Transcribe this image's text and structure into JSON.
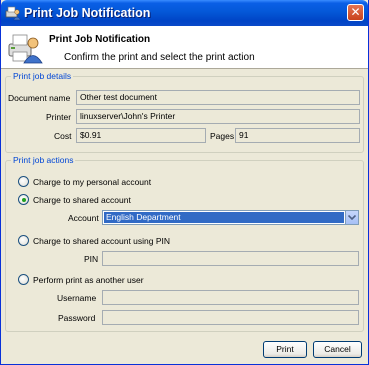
{
  "window": {
    "title": "Print Job Notification",
    "close_label": "✕"
  },
  "header": {
    "title": "Print Job Notification",
    "subtitle": "Confirm the print and select the print action"
  },
  "details": {
    "group_title": "Print job details",
    "document_label": "Document name",
    "document_value": "Other test document",
    "printer_label": "Printer",
    "printer_value": "linuxserver\\John's Printer",
    "cost_label": "Cost",
    "cost_value": "$0.91",
    "pages_label": "Pages",
    "pages_value": "91"
  },
  "actions": {
    "group_title": "Print job actions",
    "options": [
      {
        "label": "Charge to my personal account",
        "selected": false
      },
      {
        "label": "Charge to shared account",
        "selected": true
      },
      {
        "label": "Charge to shared account using PIN",
        "selected": false
      },
      {
        "label": "Perform print as another user",
        "selected": false
      }
    ],
    "account_label": "Account",
    "account_value": "English Department",
    "pin_label": "PIN",
    "pin_value": "",
    "username_label": "Username",
    "username_value": "",
    "password_label": "Password",
    "password_value": ""
  },
  "buttons": {
    "print": "Print",
    "cancel": "Cancel"
  }
}
